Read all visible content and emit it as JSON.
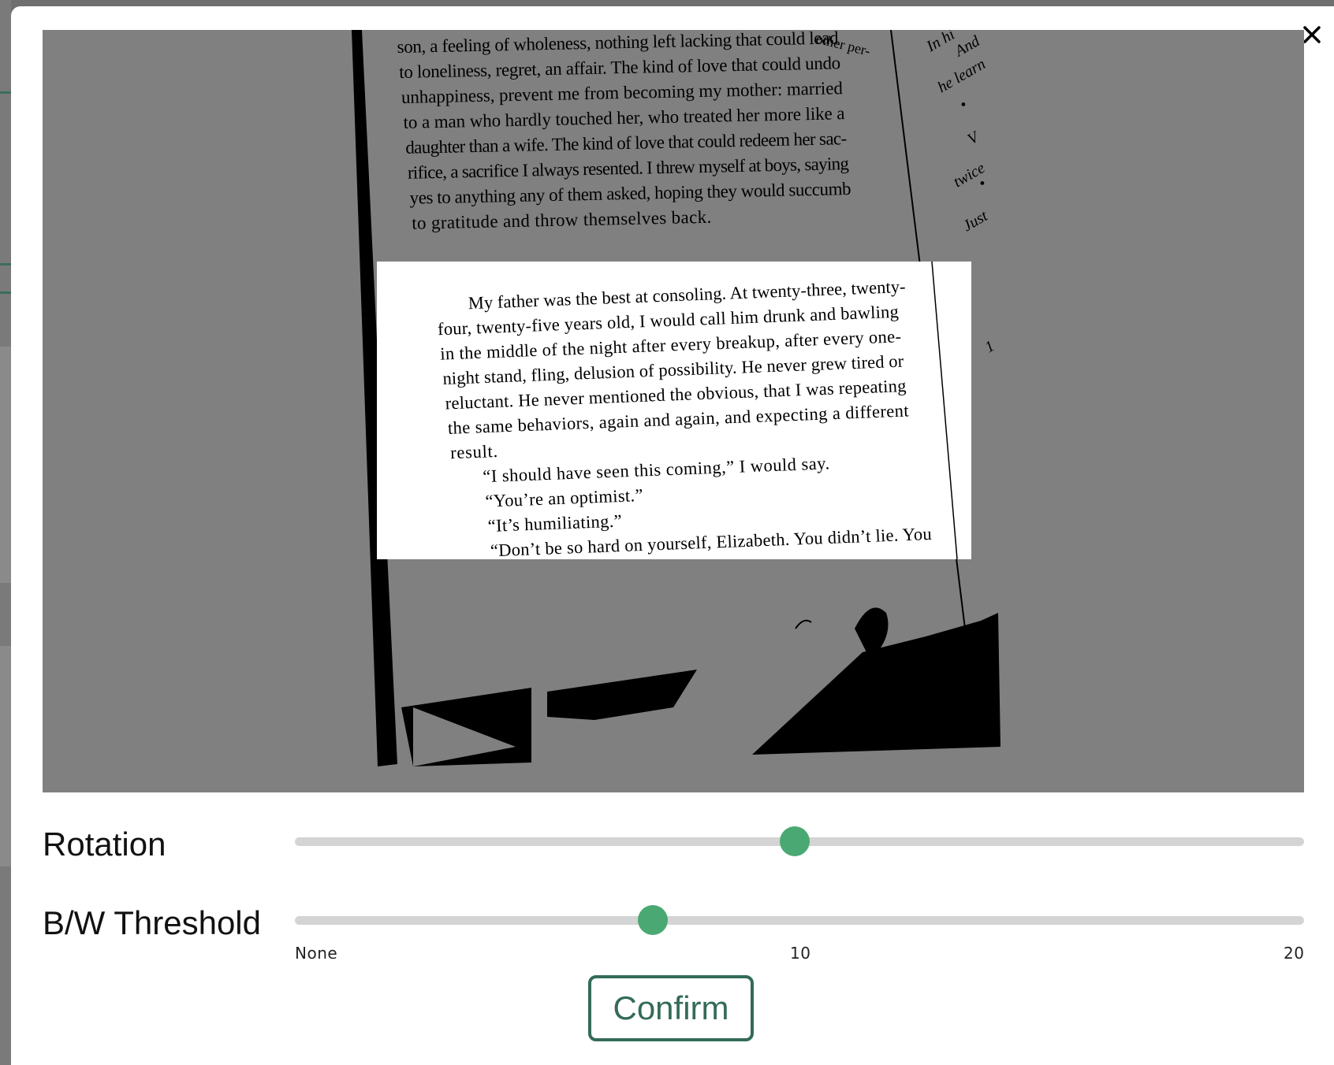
{
  "preview": {
    "top_lines": [
      "son, a feeling of wholeness, nothing left lacking that could lead",
      "to loneliness, regret, an affair. The kind of love that could undo",
      "unhappiness, prevent me from becoming my mother: married",
      "to a man who hardly touched her, who treated her more like a",
      "daughter than a wife. The kind of love that could redeem her sac-",
      "rifice, a sacrifice I always resented. I threw myself at boys, saying",
      "yes to anything any of them asked, hoping they would succumb",
      "to gratitude and throw themselves back."
    ],
    "top_partial": "other per-",
    "crop_lines": [
      "My father was the best at consoling. At twenty-three, twenty-",
      "four, twenty-five years old, I would call him drunk and bawling",
      "in the middle of the night after every breakup, after every one-",
      "night stand, fling, delusion of possibility. He never grew tired or",
      "reluctant. He never mentioned the obvious, that I was repeating",
      "the same behaviors, again and again, and expecting a different",
      "result.",
      "“I should have seen this coming,” I would say.",
      "“You’re an optimist.”",
      "“It’s humiliating.”",
      "“Don’t be so hard on yourself, Elizabeth. You didn’t lie. You"
    ],
    "side_words": [
      "In hi",
      "And",
      "he learn",
      "•",
      "V",
      "twice",
      "•",
      "Just",
      "1"
    ]
  },
  "controls": {
    "rotation_label": "Rotation",
    "rotation_value": 0.495,
    "threshold_label": "B/W Threshold",
    "threshold_value": 0.355,
    "ticks": {
      "min": "None",
      "mid": "10",
      "max": "20"
    }
  },
  "confirm_label": "Confirm",
  "colors": {
    "accent": "#4aa873",
    "button_border": "#336b58",
    "preview_bg": "#808080"
  },
  "icons": {
    "close": "close-icon"
  }
}
